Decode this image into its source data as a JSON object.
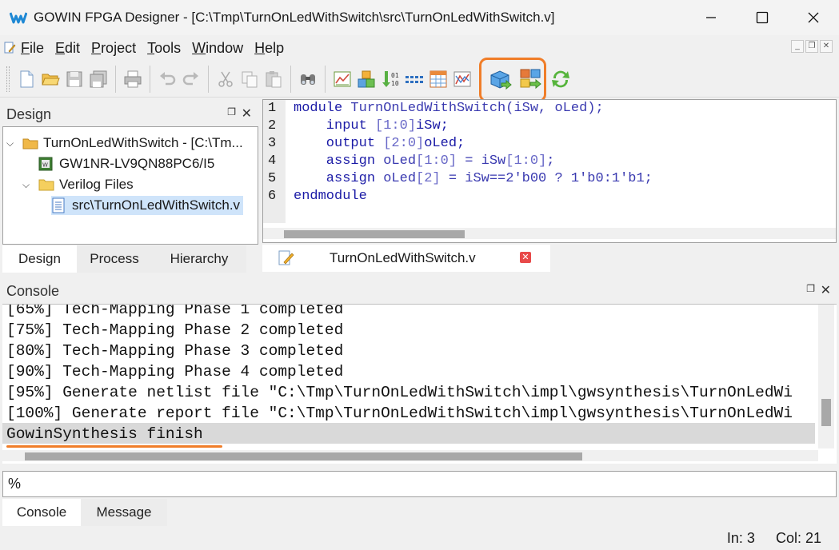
{
  "window": {
    "title": "GOWIN FPGA Designer - [C:\\Tmp\\TurnOnLedWithSwitch\\src\\TurnOnLedWithSwitch.v]"
  },
  "menu": {
    "items": [
      {
        "label": "File",
        "accel": "F"
      },
      {
        "label": "Edit",
        "accel": "E"
      },
      {
        "label": "Project",
        "accel": "P"
      },
      {
        "label": "Tools",
        "accel": "T"
      },
      {
        "label": "Window",
        "accel": "W"
      },
      {
        "label": "Help",
        "accel": "H"
      }
    ]
  },
  "toolbar": {
    "icons": [
      "new-file-icon",
      "open-folder-icon",
      "save-icon",
      "save-all-icon",
      "print-icon",
      "undo-icon",
      "redo-icon",
      "cut-icon",
      "copy-icon",
      "paste-icon",
      "find-icon",
      "schematic-icon",
      "ip-core-icon",
      "binary-sort-icon",
      "timing-icon",
      "table-icon",
      "analyzer-icon",
      "run-synthesis-icon",
      "place-route-icon",
      "refresh-icon"
    ],
    "highlight_color": "#f07d28"
  },
  "design_panel": {
    "title": "Design",
    "tree": [
      {
        "label": "TurnOnLedWithSwitch - [C:\\Tm...",
        "level": 0,
        "expanded": true,
        "icon": "project-folder-icon"
      },
      {
        "label": "GW1NR-LV9QN88PC6/I5",
        "level": 1,
        "icon": "chip-icon"
      },
      {
        "label": "Verilog Files",
        "level": 1,
        "expanded": true,
        "icon": "folder-icon"
      },
      {
        "label": "src\\TurnOnLedWithSwitch.v",
        "level": 2,
        "icon": "verilog-file-icon",
        "selected": true
      }
    ],
    "tabs": [
      "Design",
      "Process",
      "Hierarchy"
    ],
    "active_tab": "Design"
  },
  "editor": {
    "tab_label": "TurnOnLedWithSwitch.v",
    "line_numbers": [
      "1",
      "2",
      "3",
      "4",
      "5",
      "6"
    ],
    "lines": [
      [
        {
          "t": "module ",
          "c": "kw"
        },
        {
          "t": "TurnOnLedWithSwitch(iSw, oLed);",
          "c": "plain"
        }
      ],
      [
        {
          "t": "    input ",
          "c": "kw"
        },
        {
          "t": "[1:0]",
          "c": "num"
        },
        {
          "t": "iSw;",
          "c": "kw"
        }
      ],
      [
        {
          "t": "    output ",
          "c": "kw"
        },
        {
          "t": "[2:0]",
          "c": "num"
        },
        {
          "t": "oLed;",
          "c": "kw"
        }
      ],
      [
        {
          "t": "    assign ",
          "c": "kw"
        },
        {
          "t": "oLed",
          "c": "plain"
        },
        {
          "t": "[1:0]",
          "c": "num"
        },
        {
          "t": " = iSw",
          "c": "plain"
        },
        {
          "t": "[1:0]",
          "c": "num"
        },
        {
          "t": ";",
          "c": "plain"
        }
      ],
      [
        {
          "t": "    assign ",
          "c": "kw"
        },
        {
          "t": "oLed",
          "c": "plain"
        },
        {
          "t": "[2]",
          "c": "num"
        },
        {
          "t": " = iSw==2'b00 ? 1'b0:1'b1;",
          "c": "plain"
        }
      ],
      [
        {
          "t": "endmodule",
          "c": "kw"
        }
      ]
    ]
  },
  "console": {
    "title": "Console",
    "lines": [
      "[65%] Tech-Mapping Phase 1 completed",
      "[75%] Tech-Mapping Phase 2 completed",
      "[80%] Tech-Mapping Phase 3 completed",
      "[90%] Tech-Mapping Phase 4 completed",
      "[95%] Generate netlist file \"C:\\Tmp\\TurnOnLedWithSwitch\\impl\\gwsynthesis\\TurnOnLedWi",
      "[100%] Generate report file \"C:\\Tmp\\TurnOnLedWithSwitch\\impl\\gwsynthesis\\TurnOnLedWi",
      "GowinSynthesis finish"
    ],
    "prompt": "%",
    "tabs": [
      "Console",
      "Message"
    ],
    "active_tab": "Console"
  },
  "status": {
    "line": "In: 3",
    "col": "Col: 21"
  }
}
